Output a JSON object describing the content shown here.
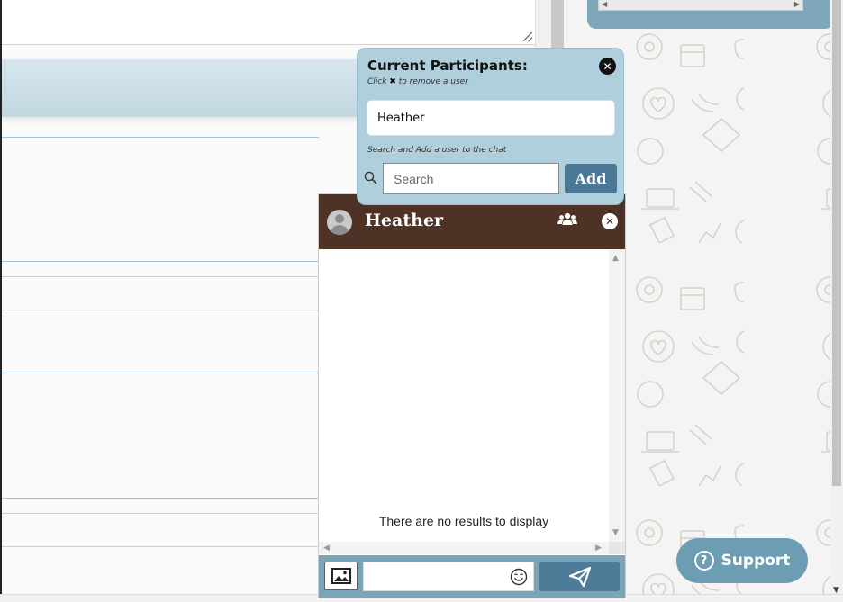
{
  "participants_popover": {
    "title": "Current Participants:",
    "hint_prefix": "Click",
    "hint_suffix": "to remove a user",
    "participants": [
      "Heather"
    ],
    "search_hint": "Search and Add a user to the chat",
    "search_placeholder": "Search",
    "add_label": "Add",
    "close_icon": "close-circle-icon"
  },
  "chat": {
    "name": "Heather",
    "empty_message": "There are no results to display",
    "message_input_value": "",
    "icons": {
      "avatar": "user-avatar-icon",
      "participants": "users-group-icon",
      "close": "close-circle-icon",
      "image": "image-icon",
      "emoji": "smiley-icon",
      "send": "paper-plane-icon"
    }
  },
  "support": {
    "label": "Support",
    "icon": "question-circle-icon"
  },
  "colors": {
    "chat_header": "#4e3226",
    "popover_bg": "#aecfdb",
    "composer_bg": "#7aa4b7",
    "button_blue": "#4b7895",
    "support_bg": "#6d9db2"
  }
}
